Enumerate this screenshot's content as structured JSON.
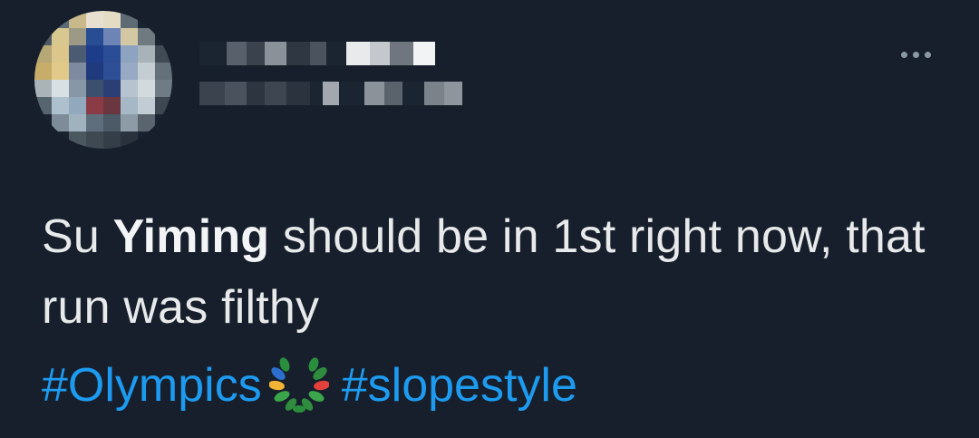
{
  "tweet": {
    "text": {
      "prefix": "Su ",
      "bold": "Yiming",
      "rest": " should be in 1st right now, that run was filthy"
    },
    "hashtags": [
      {
        "label": "#Olympics"
      },
      {
        "label": "#slopestyle"
      }
    ],
    "hashtag_emoji": "olympic-laurel-emoji"
  },
  "author": {
    "avatar": "avatar-icon",
    "name_redacted": true,
    "handle_redacted": true
  },
  "actions": {
    "more_icon": "more-horizontal-icon"
  },
  "colors": {
    "background": "#161f2b",
    "text": "#e7e9ea",
    "hashtag": "#1d9bf0",
    "muted": "#8b98a5"
  }
}
